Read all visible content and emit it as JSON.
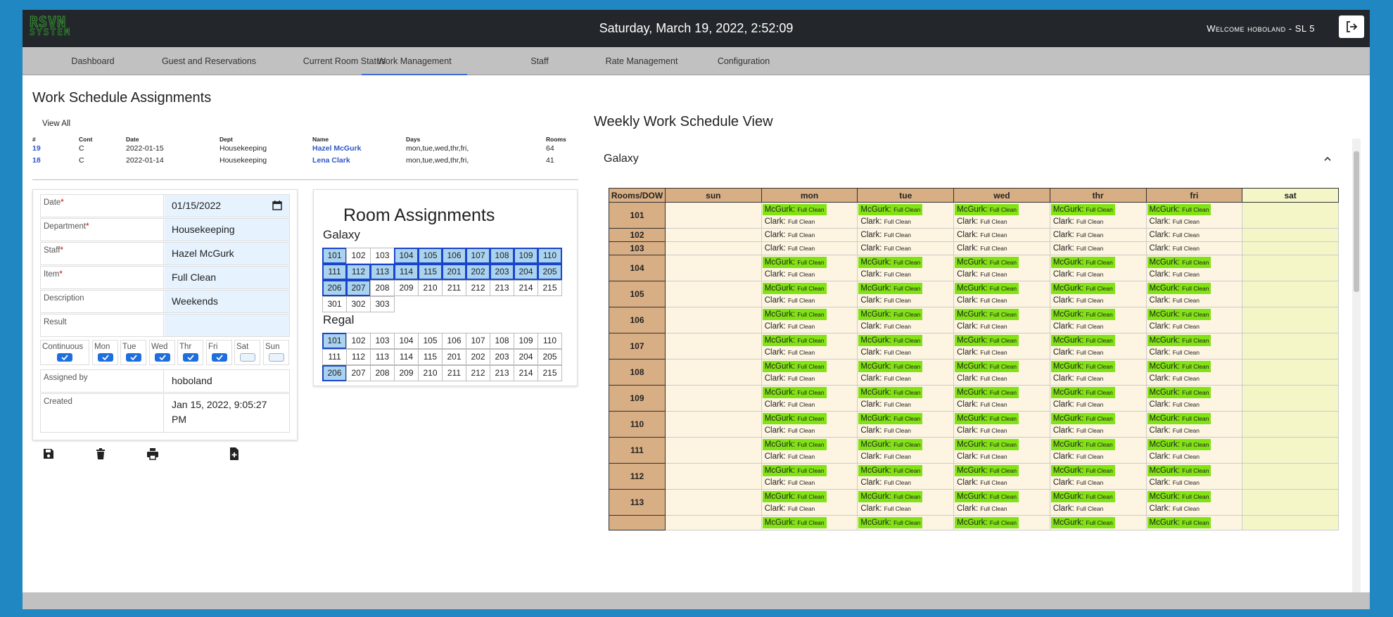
{
  "header": {
    "logo_line1": "RSVN",
    "logo_line2": "SYSTEM",
    "datetime": "Saturday, March 19, 2022, 2:52:09",
    "welcome": "Welcome hoboland - SL 5"
  },
  "nav": {
    "tabs": [
      {
        "label": "Dashboard"
      },
      {
        "label": "Guest and Reservations"
      },
      {
        "label": "Current Room Status"
      },
      {
        "label": "Work Management"
      },
      {
        "label": "Staff"
      },
      {
        "label": "Rate Management"
      },
      {
        "label": "Configuration"
      }
    ],
    "active": "Work Management"
  },
  "page_title": "Work Schedule Assignments",
  "view_all": "View All",
  "schedule": {
    "headers": [
      "#",
      "Cont",
      "Date",
      "Dept",
      "Name",
      "Days",
      "Rooms"
    ],
    "rows": [
      {
        "id": "19",
        "cont": "C",
        "date": "2022-01-15",
        "dept": "Housekeeping",
        "name": "Hazel McGurk",
        "days": "mon,tue,wed,thr,fri,",
        "rooms": "64"
      },
      {
        "id": "18",
        "cont": "C",
        "date": "2022-01-14",
        "dept": "Housekeeping",
        "name": "Lena Clark",
        "days": "mon,tue,wed,thr,fri,",
        "rooms": "41"
      }
    ]
  },
  "form": {
    "date_label": "Date",
    "date_value": "01/15/2022",
    "dept_label": "Department",
    "dept_value": "Housekeeping",
    "staff_label": "Staff",
    "staff_value": "Hazel McGurk",
    "item_label": "Item",
    "item_value": "Full Clean",
    "desc_label": "Description",
    "desc_value": "Weekends",
    "result_label": "Result",
    "result_value": "",
    "required_mark": "*",
    "days": [
      {
        "label": "Continuous",
        "checked": true
      },
      {
        "label": "Mon",
        "checked": true
      },
      {
        "label": "Tue",
        "checked": true
      },
      {
        "label": "Wed",
        "checked": true
      },
      {
        "label": "Thr",
        "checked": true
      },
      {
        "label": "Fri",
        "checked": true
      },
      {
        "label": "Sat",
        "checked": false
      },
      {
        "label": "Sun",
        "checked": false
      }
    ],
    "assigned_label": "Assigned by",
    "assigned_value": "hoboland",
    "created_label": "Created",
    "created_value": "Jan 15, 2022, 9:05:27 PM"
  },
  "room_assignments": {
    "title": "Room Assignments",
    "groups": [
      {
        "name": "Galaxy",
        "rooms": [
          "101",
          "102",
          "103",
          "104",
          "105",
          "106",
          "107",
          "108",
          "109",
          "110",
          "111",
          "112",
          "113",
          "114",
          "115",
          "201",
          "202",
          "203",
          "204",
          "205",
          "206",
          "207",
          "208",
          "209",
          "210",
          "211",
          "212",
          "213",
          "214",
          "215",
          "301",
          "302",
          "303"
        ],
        "selected": [
          "101",
          "104",
          "105",
          "106",
          "107",
          "108",
          "109",
          "110",
          "111",
          "112",
          "113",
          "114",
          "115",
          "201",
          "202",
          "203",
          "204",
          "205",
          "206",
          "207"
        ]
      },
      {
        "name": "Regal",
        "rooms": [
          "101",
          "102",
          "103",
          "104",
          "105",
          "106",
          "107",
          "108",
          "109",
          "110",
          "111",
          "112",
          "113",
          "114",
          "115",
          "201",
          "202",
          "203",
          "204",
          "205",
          "206",
          "207",
          "208",
          "209",
          "210",
          "211",
          "212",
          "213",
          "214",
          "215"
        ],
        "selected": [
          "101",
          "206"
        ]
      }
    ]
  },
  "weekly": {
    "title": "Weekly Work Schedule View",
    "group": "Galaxy",
    "corner": "Rooms/DOW",
    "days": [
      "sun",
      "mon",
      "tue",
      "wed",
      "thr",
      "fri",
      "sat"
    ],
    "staff_a": "McGurk:",
    "staff_b": "Clark:",
    "task": "Full Clean",
    "rows": [
      {
        "room": "101",
        "a": true,
        "b": true
      },
      {
        "room": "102",
        "a": false,
        "b": true
      },
      {
        "room": "103",
        "a": false,
        "b": true
      },
      {
        "room": "104",
        "a": true,
        "b": true
      },
      {
        "room": "105",
        "a": true,
        "b": true
      },
      {
        "room": "106",
        "a": true,
        "b": true
      },
      {
        "room": "107",
        "a": true,
        "b": true
      },
      {
        "room": "108",
        "a": true,
        "b": true
      },
      {
        "room": "109",
        "a": true,
        "b": true
      },
      {
        "room": "110",
        "a": true,
        "b": true
      },
      {
        "room": "111",
        "a": true,
        "b": true
      },
      {
        "room": "112",
        "a": true,
        "b": true
      },
      {
        "room": "113",
        "a": true,
        "b": true
      },
      {
        "room": "",
        "a": true,
        "b": false
      }
    ]
  }
}
